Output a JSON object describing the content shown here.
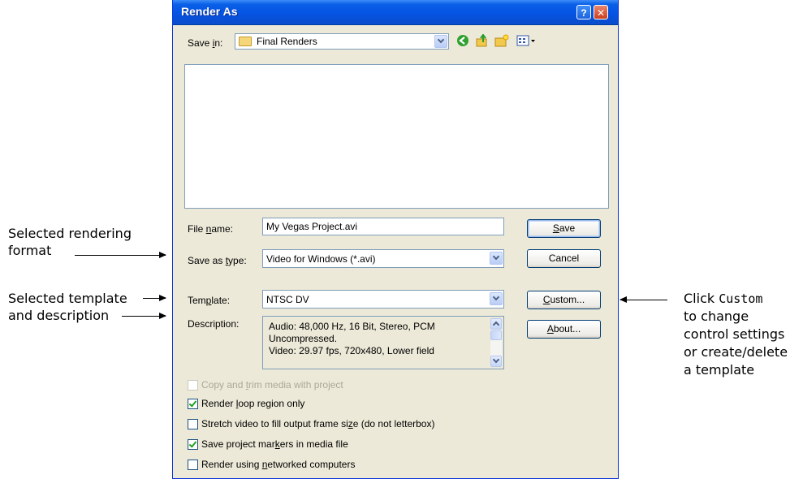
{
  "annotations": {
    "rendering_format": [
      "Selected rendering",
      "format"
    ],
    "template": [
      "Selected template",
      "and description"
    ],
    "custom": {
      "click": "Click",
      "custom": "Custom",
      "rest": [
        "to change",
        "control settings",
        "or create/delete",
        "a template"
      ]
    }
  },
  "dialog": {
    "title": "Render As",
    "help_btn": "?",
    "close_btn": "✕",
    "save_in": {
      "label_pre": "Save ",
      "label_u": "i",
      "label_post": "n:",
      "value": "Final Renders"
    },
    "toolbar": {
      "back": "back-icon",
      "up": "up-folder-icon",
      "new_folder": "new-folder-icon",
      "views": "views-menu-icon"
    },
    "file_name": {
      "label_pre": "File ",
      "label_u": "n",
      "label_post": "ame:",
      "value": "My Vegas Project.avi"
    },
    "save_as_type": {
      "label_pre": "Save as ",
      "label_u": "t",
      "label_post": "ype:",
      "value": "Video for Windows (*.avi)"
    },
    "template": {
      "label_pre": "Tem",
      "label_u": "p",
      "label_post": "late:",
      "value": "NTSC DV"
    },
    "description": {
      "label": "Description:",
      "text": "Audio: 48,000 Hz, 16 Bit, Stereo, PCM\nUncompressed.\nVideo: 29.97 fps, 720x480, Lower field"
    },
    "buttons": {
      "save": {
        "u": "S",
        "post": "ave"
      },
      "cancel": "Cancel",
      "custom": {
        "u": "C",
        "post": "ustom..."
      },
      "about": {
        "u": "A",
        "post": "bout..."
      }
    },
    "checkboxes": [
      {
        "pre": "Copy and ",
        "u": "t",
        "post": "rim media with project",
        "checked": false,
        "disabled": true
      },
      {
        "pre": "Render ",
        "u": "l",
        "post": "oop region only",
        "checked": true,
        "disabled": false
      },
      {
        "pre": "Stretch video to fill output frame si",
        "u": "z",
        "post": "e (do not letterbox)",
        "checked": false,
        "disabled": false
      },
      {
        "pre": "Save project mar",
        "u": "k",
        "post": "ers in media file",
        "checked": true,
        "disabled": false
      },
      {
        "pre": "Render using ",
        "u": "n",
        "post": "etworked computers",
        "checked": false,
        "disabled": false
      }
    ]
  },
  "colors": {
    "titlebar": "#0554e3",
    "dialog_bg": "#ece9d8",
    "check": "#21a121"
  }
}
